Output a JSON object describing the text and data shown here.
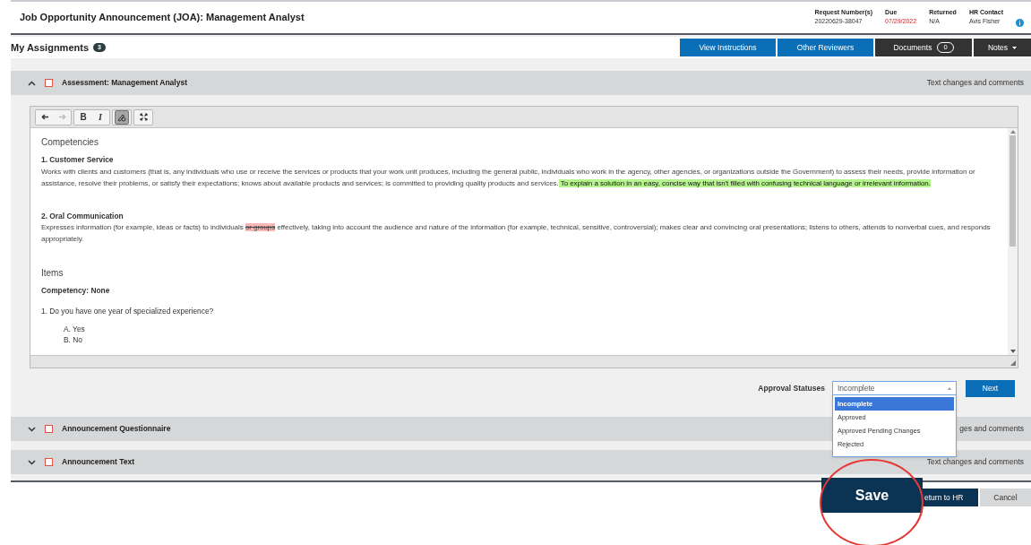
{
  "header": {
    "title": "Job Opportunity Announcement (JOA): Management Analyst",
    "meta": [
      {
        "label": "Request Number(s)",
        "value": "20220629-38047",
        "alert": false
      },
      {
        "label": "Due",
        "value": "07/29/2022",
        "alert": true
      },
      {
        "label": "Returned",
        "value": "N/A",
        "alert": false
      },
      {
        "label": "HR Contact",
        "value": "Avis Fisher",
        "alert": false
      }
    ]
  },
  "assignments": {
    "title": "My Assignments",
    "count": "3",
    "buttons": [
      {
        "label": "View Instructions",
        "kind": "primary"
      },
      {
        "label": "Other Reviewers",
        "kind": "primary"
      },
      {
        "label": "Documents",
        "kind": "counter",
        "count": "0"
      },
      {
        "label": "Notes",
        "kind": "menu"
      }
    ]
  },
  "sections": [
    {
      "title": "Assessment: Management Analyst",
      "expanded": true,
      "checked": false,
      "note": "Text changes and comments"
    },
    {
      "title": "Announcement Questionnaire",
      "expanded": false,
      "checked": false,
      "note": "ges and comments"
    },
    {
      "title": "Announcement Text",
      "expanded": false,
      "checked": false,
      "note": "Text changes and comments"
    }
  ],
  "editor": {
    "toolbar": [
      {
        "kind": "undo",
        "disabled": false,
        "active": false
      },
      {
        "kind": "redo",
        "disabled": true,
        "active": false
      },
      {
        "kind": "bold",
        "label": "B",
        "disabled": false,
        "active": false
      },
      {
        "kind": "italic",
        "label": "I",
        "disabled": false,
        "active": false
      },
      {
        "kind": "track",
        "disabled": false,
        "active": true
      },
      {
        "kind": "fullscreen",
        "disabled": false,
        "active": false
      }
    ],
    "blocks": [
      {
        "kind": "heading",
        "text": "Competencies"
      },
      {
        "kind": "title",
        "text": "1. Customer Service"
      },
      {
        "kind": "paragraph",
        "segments": [
          {
            "kind": "plain",
            "text": "Works with clients and customers (that is, any individuals who use or receive the services or products that your work unit produces, including the general public, individuals who work in the agency, other agencies, or organizations outside the Government) to assess their needs, provide information or assistance, resolve their problems, or satisfy their expectations; knows about available products and services; is committed to providing quality products and services."
          },
          {
            "kind": "insert",
            "text": " To explain a solution in an easy, concise way that isn't filled with confusing technical language or irrelevant information."
          }
        ]
      },
      {
        "kind": "title",
        "text": "2. Oral Communication"
      },
      {
        "kind": "paragraph",
        "segments": [
          {
            "kind": "plain",
            "text": "Expresses information (for example, ideas or facts) to individuals "
          },
          {
            "kind": "delete",
            "text": "or groups"
          },
          {
            "kind": "plain",
            "text": " effectively, taking into account the audience and nature of the information (for example, technical, sensitive, controversial); makes clear and convincing oral presentations; listens to others, attends to nonverbal cues, and responds appropriately."
          }
        ]
      },
      {
        "kind": "heading",
        "text": "Items"
      },
      {
        "kind": "title",
        "text": "Competency: None"
      },
      {
        "kind": "question",
        "text": "1. Do you have one year of specialized experience?"
      },
      {
        "kind": "option",
        "text": "A. Yes"
      },
      {
        "kind": "option",
        "text": "B. No"
      }
    ]
  },
  "approval": {
    "label": "Approval Statuses",
    "value": "Incomplete",
    "options": [
      {
        "label": "Incomplete",
        "selected": true
      },
      {
        "label": "Approved",
        "selected": false
      },
      {
        "label": "Approved Pending Changes",
        "selected": false
      },
      {
        "label": "Rejected",
        "selected": false
      }
    ],
    "next": "Next"
  },
  "footer": {
    "save": "Save",
    "return": "eturn to HR",
    "cancel": "Cancel"
  }
}
